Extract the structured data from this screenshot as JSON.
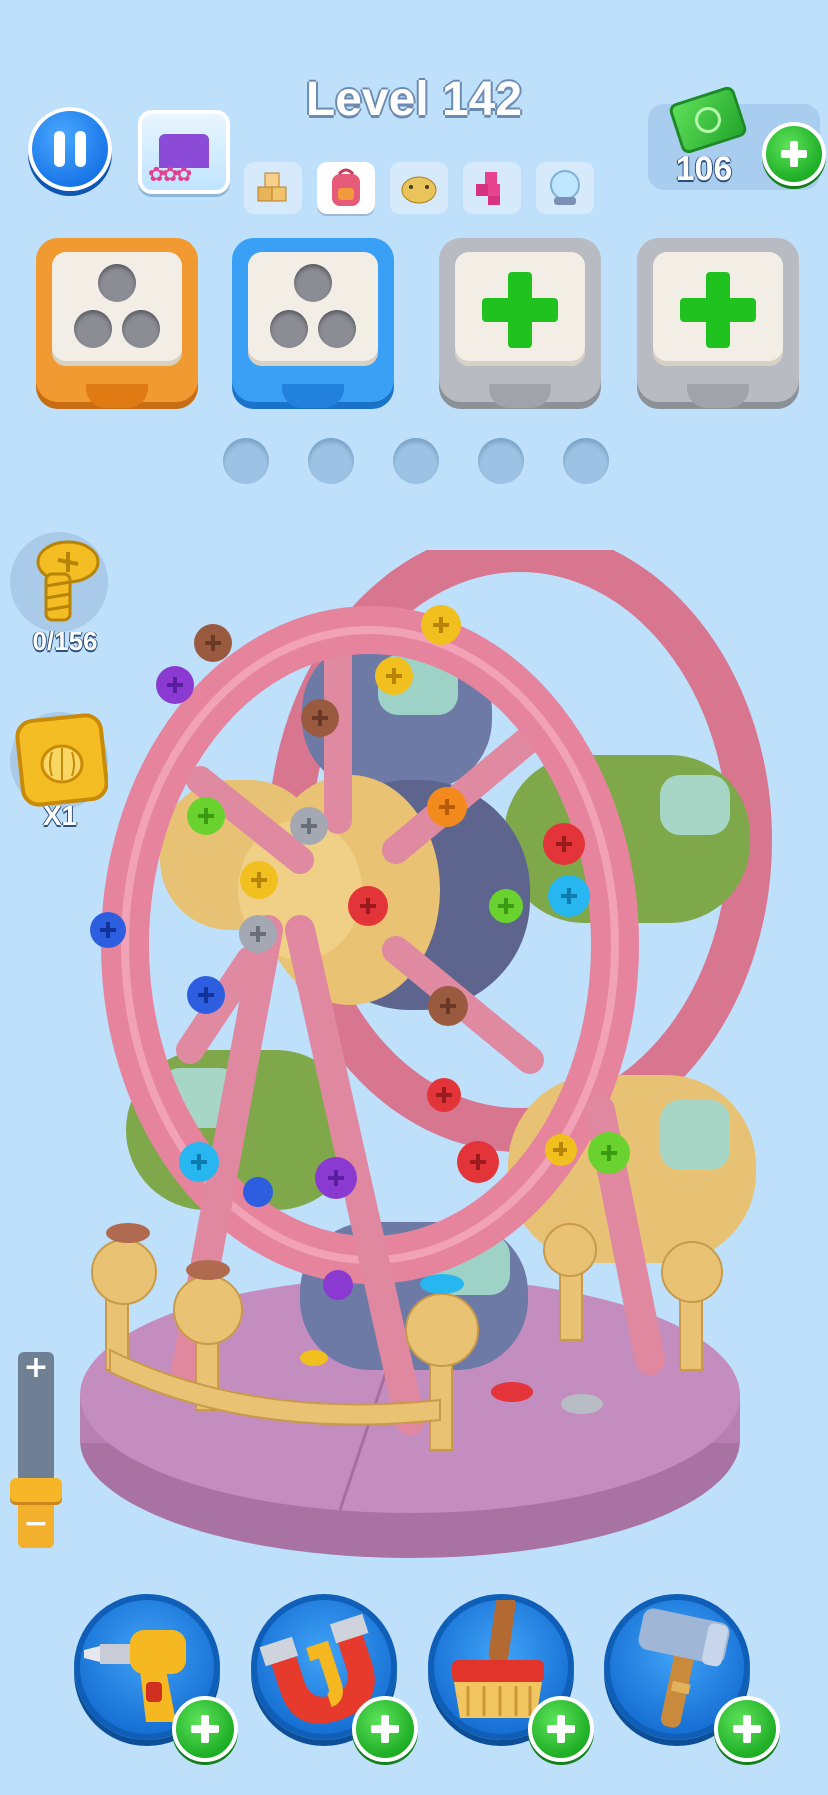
{
  "header": {
    "level_title": "Level 142",
    "money_value": "106"
  },
  "objectives": [
    {
      "icon": "cubes-icon",
      "state": "idle"
    },
    {
      "icon": "backpack-icon",
      "state": "active"
    },
    {
      "icon": "piggy-icon",
      "state": "idle"
    },
    {
      "icon": "pink-blocks-icon",
      "state": "idle"
    },
    {
      "icon": "snowglobe-icon",
      "state": "idle"
    }
  ],
  "boxes": [
    {
      "color": "orange",
      "type": "holes",
      "holes": 3
    },
    {
      "color": "blue",
      "type": "holes",
      "holes": 3
    },
    {
      "color": "gray",
      "type": "locked-add"
    },
    {
      "color": "gray",
      "type": "locked-add"
    }
  ],
  "holding_slots": 5,
  "side": {
    "screw_counter": "0/156",
    "gold_count": "X1"
  },
  "tools": [
    {
      "name": "drill"
    },
    {
      "name": "magnet"
    },
    {
      "name": "brush"
    },
    {
      "name": "hammer"
    }
  ],
  "zoom": {
    "plus": "+",
    "minus": "−",
    "level_fraction": 0.25
  },
  "colors": {
    "background": "#bfe0fb",
    "wheel": "#e6849e",
    "base": "#c286b8",
    "accent_green": "#1fc21f",
    "tool_blue": "#1770d4"
  }
}
